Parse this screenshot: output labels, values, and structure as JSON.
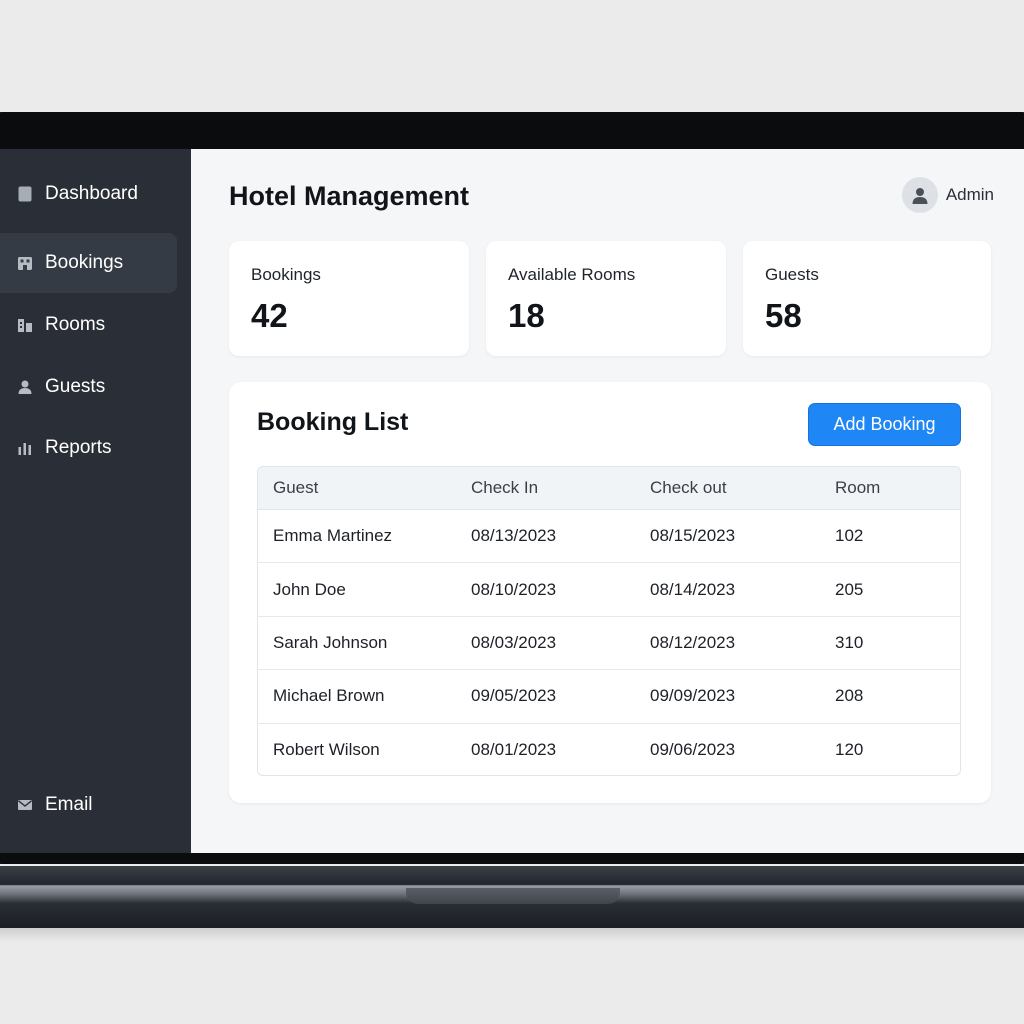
{
  "sidebar": {
    "items": [
      {
        "label": "Dashboard",
        "icon": "dashboard-icon"
      },
      {
        "label": "Bookings",
        "icon": "building-icon",
        "active": true
      },
      {
        "label": "Rooms",
        "icon": "rooms-icon"
      },
      {
        "label": "Guests",
        "icon": "person-icon"
      },
      {
        "label": "Reports",
        "icon": "bar-chart-icon"
      }
    ],
    "bottom_item": {
      "label": "Email",
      "icon": "mail-icon"
    }
  },
  "header": {
    "title": "Hotel Management",
    "user": {
      "name": "Admin",
      "icon": "user-avatar-icon"
    }
  },
  "stats": [
    {
      "label": "Bookings",
      "value": "42"
    },
    {
      "label": "Available Rooms",
      "value": "18"
    },
    {
      "label": "Guests",
      "value": "58"
    }
  ],
  "booking_list": {
    "title": "Booking List",
    "add_button": "Add Booking",
    "columns": [
      "Guest",
      "Check In",
      "Check out",
      "Room"
    ],
    "rows": [
      [
        "Emma Martinez",
        "08/13/2023",
        "08/15/2023",
        "102"
      ],
      [
        "John Doe",
        "08/10/2023",
        "08/14/2023",
        "205"
      ],
      [
        "Sarah Johnson",
        "08/03/2023",
        "08/12/2023",
        "310"
      ],
      [
        "Michael Brown",
        "09/05/2023",
        "09/09/2023",
        "208"
      ],
      [
        "Robert Wilson",
        "08/01/2023",
        "09/06/2023",
        "120"
      ]
    ]
  },
  "colors": {
    "sidebar_bg": "#2a2f37",
    "active_item_bg": "#353b44",
    "accent": "#1f86f5",
    "page_bg": "#f5f6f8"
  }
}
